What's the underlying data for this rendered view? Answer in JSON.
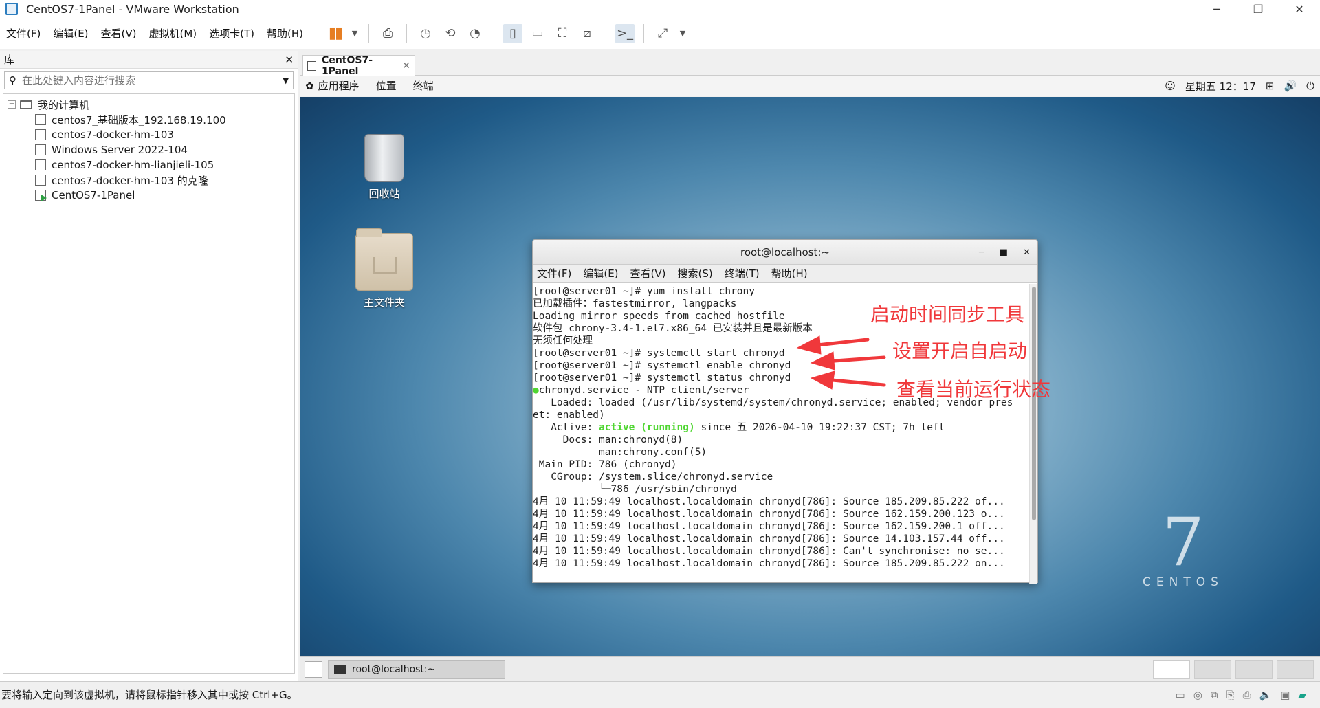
{
  "window": {
    "title": "CentOS7-1Panel - VMware Workstation",
    "min": "─",
    "max": "❐",
    "close": "✕"
  },
  "menu": [
    "文件(F)",
    "编辑(E)",
    "查看(V)",
    "虚拟机(M)",
    "选项卡(T)",
    "帮助(H)"
  ],
  "library": {
    "title": "库",
    "close": "✕",
    "search_placeholder": "在此处键入内容进行搜索",
    "root": "我的计算机",
    "items": [
      "centos7_基础版本_192.168.19.100",
      "centos7-docker-hm-103",
      "Windows Server 2022-104",
      "centos7-docker-hm-lianjieli-105",
      "centos7-docker-hm-103 的克隆",
      "CentOS7-1Panel"
    ]
  },
  "vm_tab": {
    "label": "CentOS7-1Panel",
    "close": "✕"
  },
  "gnome": {
    "menus": [
      "应用程序",
      "位置",
      "终端"
    ],
    "clock": "星期五 12：17"
  },
  "desktop": {
    "trash_label": "回收站",
    "home_label": "主文件夹",
    "logo_number": "7",
    "logo_word": "CENTOS"
  },
  "terminal": {
    "title": "root@localhost:~",
    "menus": [
      "文件(F)",
      "编辑(E)",
      "查看(V)",
      "搜索(S)",
      "终端(T)",
      "帮助(H)"
    ],
    "lines": [
      "[root@server01 ~]# yum install chrony",
      "已加载插件：fastestmirror, langpacks",
      "Loading mirror speeds from cached hostfile",
      "软件包 chrony-3.4-1.el7.x86_64 已安装并且是最新版本",
      "无须任何处理",
      "[root@server01 ~]# systemctl start chronyd",
      "[root@server01 ~]# systemctl enable chronyd",
      "[root@server01 ~]# systemctl status chronyd"
    ],
    "status_title": "chronyd.service - NTP client/server",
    "loaded_1": "   Loaded: loaded (/usr/lib/systemd/system/chronyd.service; enabled; vendor pres",
    "loaded_2": "et: enabled)",
    "active_label": "   Active: ",
    "active_state": "active (running)",
    "active_rest": " since 五 2026-04-10 19:22:37 CST; 7h left",
    "rest": [
      "     Docs: man:chronyd(8)",
      "           man:chrony.conf(5)",
      " Main PID: 786 (chronyd)",
      "   CGroup: /system.slice/chronyd.service",
      "           └─786 /usr/sbin/chronyd",
      "",
      "4月 10 11:59:49 localhost.localdomain chronyd[786]: Source 185.209.85.222 of...",
      "4月 10 11:59:49 localhost.localdomain chronyd[786]: Source 162.159.200.123 o...",
      "4月 10 11:59:49 localhost.localdomain chronyd[786]: Source 162.159.200.1 off...",
      "4月 10 11:59:49 localhost.localdomain chronyd[786]: Source 14.103.157.44 off...",
      "4月 10 11:59:49 localhost.localdomain chronyd[786]: Can't synchronise: no se...",
      "4月 10 11:59:49 localhost.localdomain chronyd[786]: Source 185.209.85.222 on..."
    ]
  },
  "annotations": [
    "启动时间同步工具",
    "设置开启自启动",
    "查看当前运行状态"
  ],
  "taskbar": {
    "task_label": "root@localhost:~"
  },
  "status": {
    "message": "要将输入定向到该虚拟机，请将鼠标指针移入其中或按 Ctrl+G。"
  },
  "colors": {
    "annotation": "#f0383b",
    "active_green": "#4fd631",
    "pause": "#e67e22"
  }
}
